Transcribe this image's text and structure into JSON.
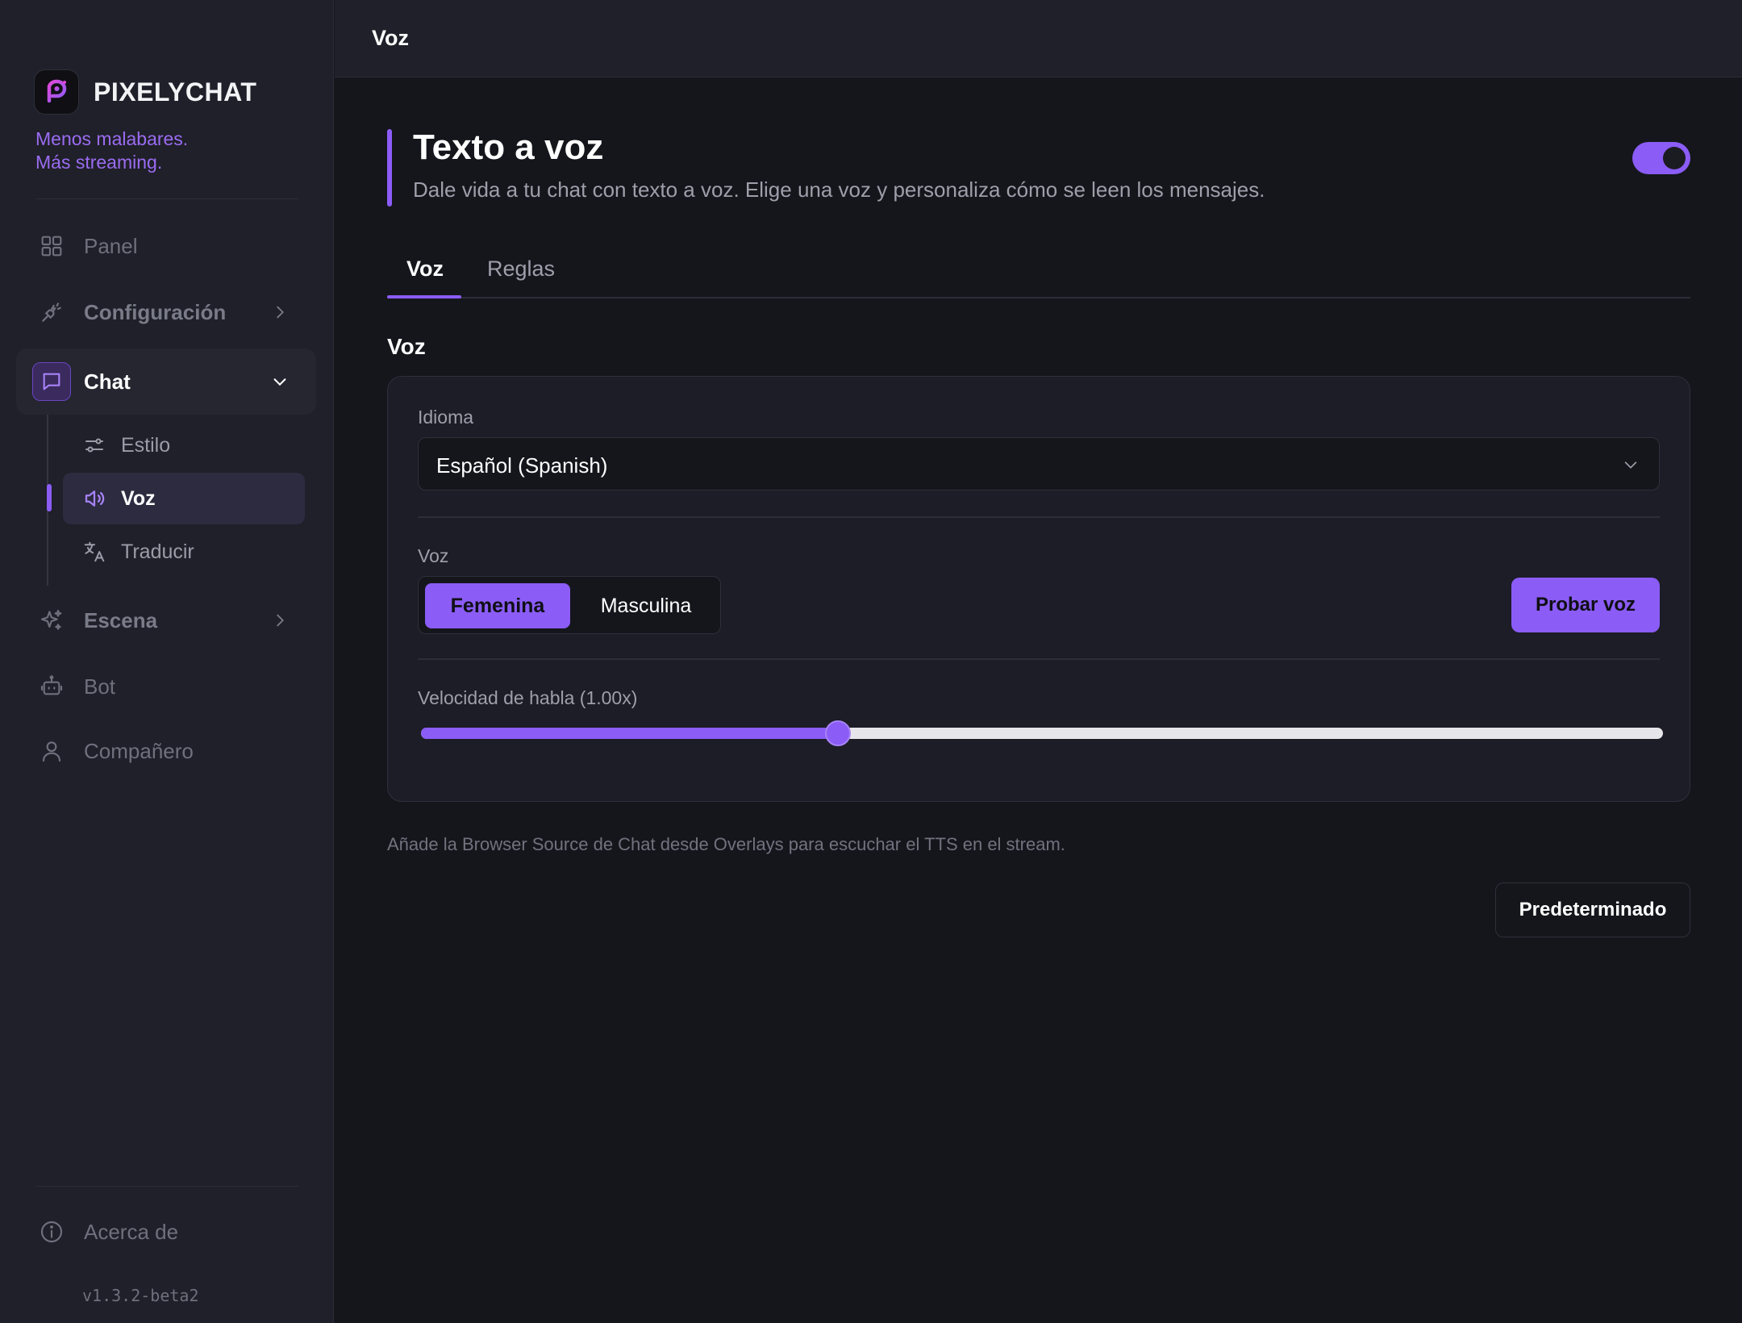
{
  "app": {
    "name": "PIXELYCHAT",
    "tagline_1": "Menos malabares.",
    "tagline_2": "Más streaming.",
    "version": "v1.3.2-beta2"
  },
  "sidebar": {
    "items": [
      {
        "label": "Panel",
        "icon": "grid-icon"
      },
      {
        "label": "Configuración",
        "icon": "plug-icon"
      },
      {
        "label": "Chat",
        "icon": "chat-bubble-icon"
      },
      {
        "label": "Escena",
        "icon": "sparkle-icon"
      },
      {
        "label": "Bot",
        "icon": "robot-icon"
      },
      {
        "label": "Compañero",
        "icon": "user-icon"
      }
    ],
    "chat_sub": [
      {
        "label": "Estilo",
        "icon": "sliders-icon"
      },
      {
        "label": "Voz",
        "icon": "speaker-icon"
      },
      {
        "label": "Traducir",
        "icon": "translate-icon"
      }
    ],
    "about": {
      "label": "Acerca de",
      "icon": "info-icon"
    }
  },
  "topbar": {
    "title": "Voz"
  },
  "hero": {
    "title": "Texto a voz",
    "subtitle": "Dale vida a tu chat con texto a voz. Elige una voz y personaliza cómo se leen los mensajes.",
    "enabled": true
  },
  "tabs": [
    {
      "label": "Voz",
      "active": true
    },
    {
      "label": "Reglas",
      "active": false
    }
  ],
  "section": {
    "title": "Voz"
  },
  "form": {
    "language_label": "Idioma",
    "language_value": "Español (Spanish)",
    "voice_label": "Voz",
    "voice_options": [
      {
        "label": "Femenina",
        "selected": true
      },
      {
        "label": "Masculina",
        "selected": false
      }
    ],
    "test_button": "Probar voz",
    "speed_label": "Velocidad de habla (1.00x)",
    "speed_fraction": 0.336
  },
  "hint": "Añade la Browser Source de Chat desde Overlays para escuchar el TTS en el stream.",
  "reset_button": "Predeterminado",
  "colors": {
    "accent": "#8b5cf6",
    "background": "#15161c",
    "sidebar": "#1f2029"
  }
}
